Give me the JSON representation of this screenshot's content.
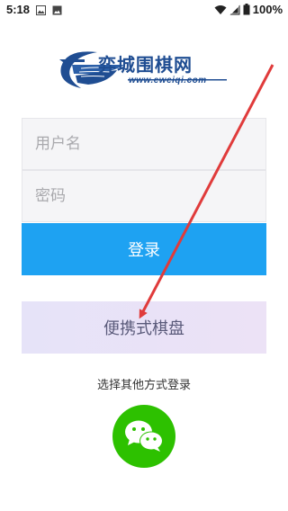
{
  "status_bar": {
    "time": "5:18",
    "battery_text": "100%",
    "icons": [
      "image-icon",
      "image-icon",
      "wifi-icon",
      "signal-icon",
      "battery-icon"
    ]
  },
  "logo": {
    "title": "弈城围棋网",
    "url": "www.eweiqi.com"
  },
  "form": {
    "username_placeholder": "用户名",
    "password_placeholder": "密码",
    "login_label": "登录"
  },
  "portable_label": "便携式棋盘",
  "other_login_label": "选择其他方式登录",
  "wechat_icon": "wechat-icon",
  "colors": {
    "login_button": "#1ea2f2",
    "wechat": "#2dc100",
    "brand": "#1f4d92",
    "annotation_arrow": "#e03b3b"
  }
}
